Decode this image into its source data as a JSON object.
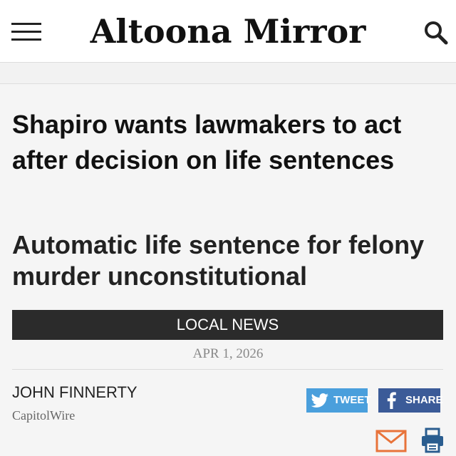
{
  "header": {
    "logo_text": "Altoona Mirror"
  },
  "article": {
    "headline": "Shapiro wants lawmakers to act after decision on life sentences",
    "subhead": "Automatic life sentence for felony murder unconstitutional",
    "section": "LOCAL NEWS",
    "date": "APR 1, 2026",
    "author": "JOHN FINNERTY",
    "source": "CapitolWire"
  },
  "share": {
    "tweet_label": "TWEET",
    "facebook_label": "SHARE"
  },
  "colors": {
    "twitter": "#4a9fdc",
    "facebook": "#3b5b98",
    "section_bar": "#2b2b2b",
    "mail_icon": "#e8733a",
    "print_icon": "#2a5d8f"
  },
  "icons": [
    "menu-icon",
    "search-icon",
    "twitter-icon",
    "facebook-icon",
    "mail-icon",
    "print-icon"
  ]
}
